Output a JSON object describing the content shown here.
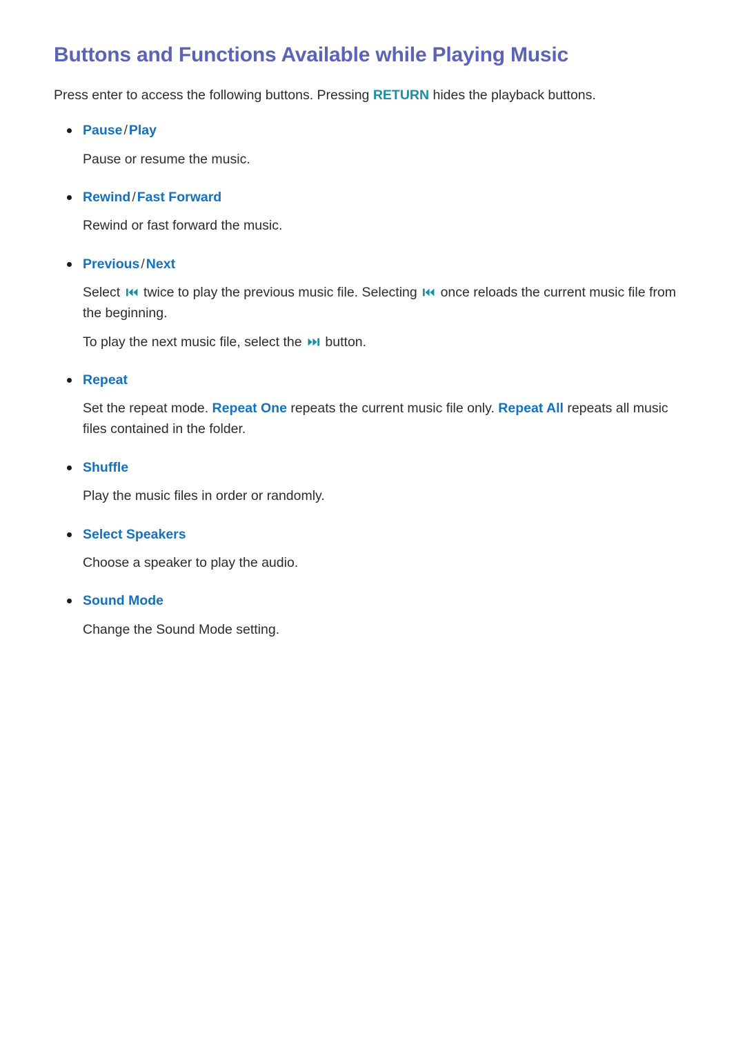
{
  "page": {
    "title": "Buttons and Functions Available while Playing Music",
    "intro": {
      "before": "Press enter to access the following buttons. Pressing ",
      "keyword": "RETURN",
      "after": " hides the playback buttons."
    }
  },
  "colors": {
    "title": "#5b63b7",
    "heading_blue": "#1272c0",
    "keyword_teal": "#1a8fa8",
    "body_text": "#2b2b2b",
    "bullet": "#1a1a1a",
    "background": "#ffffff"
  },
  "items": [
    {
      "head_parts": [
        "Pause",
        "Play"
      ],
      "separator": "/",
      "body": "Pause or resume the music."
    },
    {
      "head_parts": [
        "Rewind",
        "Fast Forward"
      ],
      "separator": "/",
      "body": "Rewind or fast forward the music."
    },
    {
      "head_parts": [
        "Previous",
        "Next"
      ],
      "separator": "/",
      "body_1_a": "Select ",
      "body_1_icon_1": "skip-back-icon",
      "body_1_b": " twice to play the previous music file. Selecting ",
      "body_1_icon_2": "skip-back-icon",
      "body_1_c": " once reloads the current music file from the beginning.",
      "body_2_a": "To play the next music file, select the ",
      "body_2_icon": "skip-forward-icon",
      "body_2_b": " button."
    },
    {
      "head_parts": [
        "Repeat"
      ],
      "body_a": "Set the repeat mode. ",
      "body_kw_1": "Repeat One",
      "body_b": " repeats the current music file only. ",
      "body_kw_2": "Repeat All",
      "body_c": " repeats all music files contained in the folder."
    },
    {
      "head_parts": [
        "Shuffle"
      ],
      "body": "Play the music files in order or randomly."
    },
    {
      "head_parts": [
        "Select Speakers"
      ],
      "body": "Choose a speaker to play the audio."
    },
    {
      "head_parts": [
        "Sound Mode"
      ],
      "body": "Change the Sound Mode setting."
    }
  ]
}
